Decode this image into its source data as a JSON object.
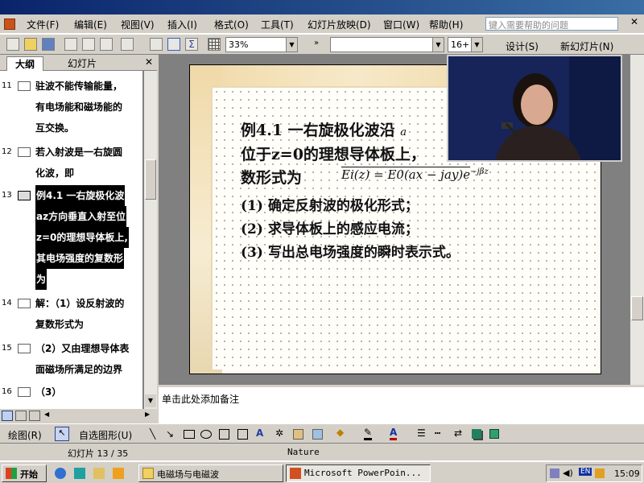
{
  "menu": {
    "items": [
      "文件(F)",
      "编辑(E)",
      "视图(V)",
      "插入(I)",
      "格式(O)",
      "工具(T)",
      "幻灯片放映(D)",
      "窗口(W)",
      "帮助(H)"
    ],
    "help_placeholder": "键入需要帮助的问题"
  },
  "toolbar": {
    "zoom": "33%",
    "font_size": "16+",
    "design_label": "设计(S)",
    "new_slide_label": "新幻灯片(N)"
  },
  "left_tabs": {
    "outline": "大纲",
    "slides": "幻灯片"
  },
  "outline": [
    {
      "num": "11",
      "lines": [
        "驻波不能传输能量，",
        "有电场能和磁场能的",
        "互交换。"
      ]
    },
    {
      "num": "12",
      "lines": [
        "若入射波是一右旋圆",
        "化波，即"
      ]
    },
    {
      "num": "13",
      "lines": [
        "例4.1 一右旋极化波",
        "az方向垂直入射至位",
        "z=0的理想导体板上,",
        "其电场强度的复数形",
        "为"
      ],
      "selected": true
    },
    {
      "num": "14",
      "lines": [
        "解：（1）设反射波的",
        "复数形式为"
      ]
    },
    {
      "num": "15",
      "lines": [
        "（2）又由理想导体表",
        "面磁场所满足的边界"
      ]
    },
    {
      "num": "16",
      "lines": [
        "（3）"
      ]
    }
  ],
  "slide": {
    "line1": "例4.1 一右旋极化波沿",
    "line1_vec": "a",
    "line2": "位于z=0的理想导体板上，",
    "line3": "数形式为",
    "formula": "Ei(z) = E0(ax − jay)e",
    "formula_exp": "−jβz",
    "items": [
      "(1) 确定反射波的极化形式；",
      "(2) 求导体板上的感应电流；",
      "(3) 写出总电场强度的瞬时表示式。"
    ]
  },
  "notes_placeholder": "单击此处添加备注",
  "drawbar": {
    "draw_label": "绘图(R)",
    "autoshape_label": "自选图形(U)"
  },
  "status": {
    "slide_info": "幻灯片 13 / 35",
    "theme": "Nature"
  },
  "taskbar": {
    "start": "开始",
    "tasks": [
      "电磁场与电磁波",
      "Microsoft PowerPoin..."
    ],
    "lang": "EN",
    "clock": "15:09"
  },
  "colors": {
    "selection": "#000000",
    "titlebar": "#0a246a",
    "desktop_blue": "#3a6ea5"
  }
}
